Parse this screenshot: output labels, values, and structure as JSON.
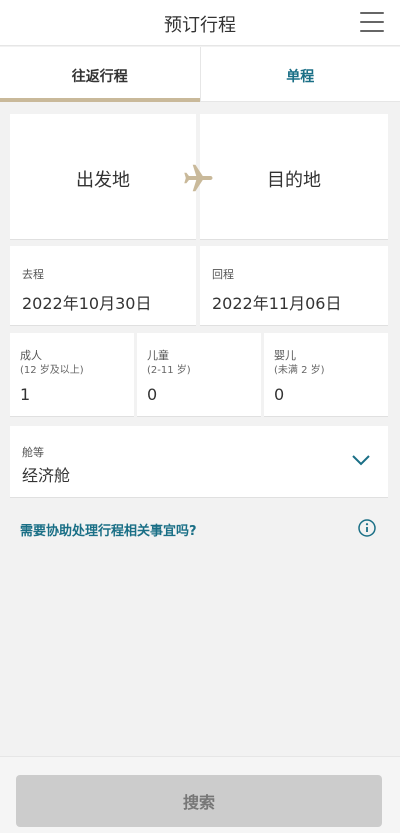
{
  "header": {
    "title": "预订行程"
  },
  "tabs": [
    {
      "label": "往返行程",
      "active": true
    },
    {
      "label": "单程",
      "active": false
    }
  ],
  "route": {
    "origin": "出发地",
    "destination": "目的地"
  },
  "dates": {
    "depart": {
      "label": "去程",
      "value": "2022年10月30日"
    },
    "return": {
      "label": "回程",
      "value": "2022年11月06日"
    }
  },
  "passengers": {
    "adult": {
      "label": "成人",
      "sub": "(12 岁及以上)",
      "value": "1"
    },
    "child": {
      "label": "儿童",
      "sub": "(2-11 岁)",
      "value": "0"
    },
    "infant": {
      "label": "婴儿",
      "sub": "(未满 2 岁)",
      "value": "0"
    }
  },
  "cabin": {
    "label": "舱等",
    "value": "经济舱"
  },
  "help": {
    "text": "需要协助处理行程相关事宜吗?"
  },
  "search": {
    "label": "搜索"
  },
  "colors": {
    "accent": "#1a6f86",
    "tab_underline": "#c9b99a",
    "plane": "#c9b99a",
    "disabled_button": "#cccccc"
  },
  "icons": {
    "menu": "menu-icon",
    "plane": "plane-icon",
    "chevron": "chevron-down-icon",
    "info": "info-icon"
  }
}
